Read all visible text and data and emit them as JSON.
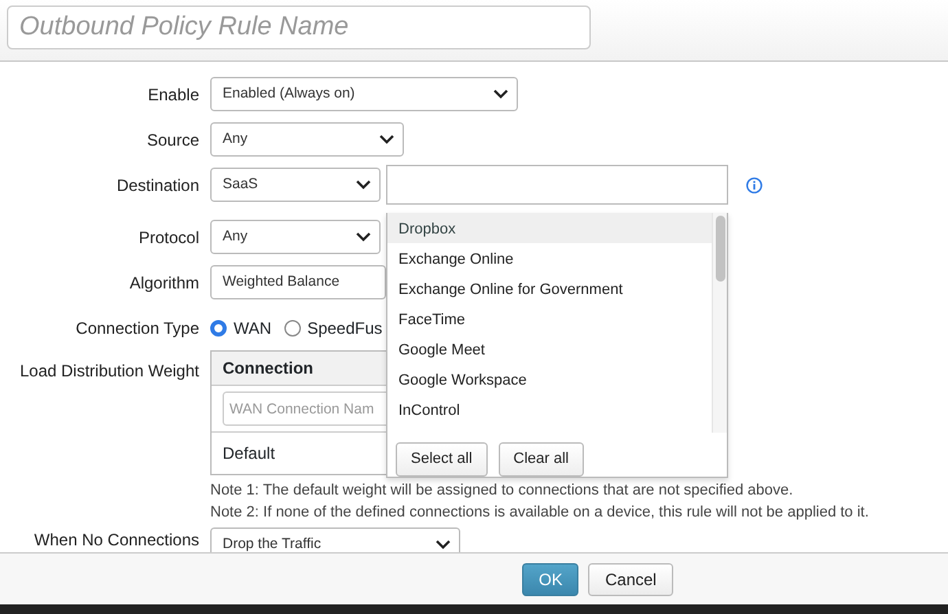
{
  "rule_name": {
    "placeholder": "Outbound Policy Rule Name"
  },
  "enable": {
    "label": "Enable",
    "value": "Enabled (Always on)"
  },
  "source": {
    "label": "Source",
    "value": "Any"
  },
  "destination": {
    "label": "Destination",
    "value": "SaaS"
  },
  "protocol": {
    "label": "Protocol",
    "value": "Any"
  },
  "algorithm": {
    "label": "Algorithm",
    "value": "Weighted Balance"
  },
  "connection_type": {
    "label": "Connection Type",
    "options": [
      {
        "label": "WAN",
        "selected": true
      },
      {
        "label": "SpeedFus",
        "selected": false
      }
    ]
  },
  "load_distribution": {
    "label": "Load Distribution Weight",
    "column": "Connection",
    "placeholder": "WAN Connection Nam",
    "row": "Default"
  },
  "notes": [
    "Note 1: The default weight will be assigned to connections that are not specified above.",
    "Note 2: If none of the defined connections is available on a device, this rule will not be applied to it."
  ],
  "when_no_connections": {
    "label": "When No Connections",
    "value": "Drop the Traffic"
  },
  "saas_dropdown": {
    "options": [
      {
        "label": "Dropbox",
        "selected": true
      },
      {
        "label": "Exchange Online",
        "selected": false
      },
      {
        "label": "Exchange Online for Government",
        "selected": false
      },
      {
        "label": "FaceTime",
        "selected": false
      },
      {
        "label": "Google Meet",
        "selected": false
      },
      {
        "label": "Google Workspace",
        "selected": false
      },
      {
        "label": "InControl",
        "selected": false
      }
    ],
    "buttons": [
      "Select all",
      "Clear all"
    ]
  },
  "footer": {
    "buttons": [
      "OK",
      "Cancel"
    ]
  }
}
